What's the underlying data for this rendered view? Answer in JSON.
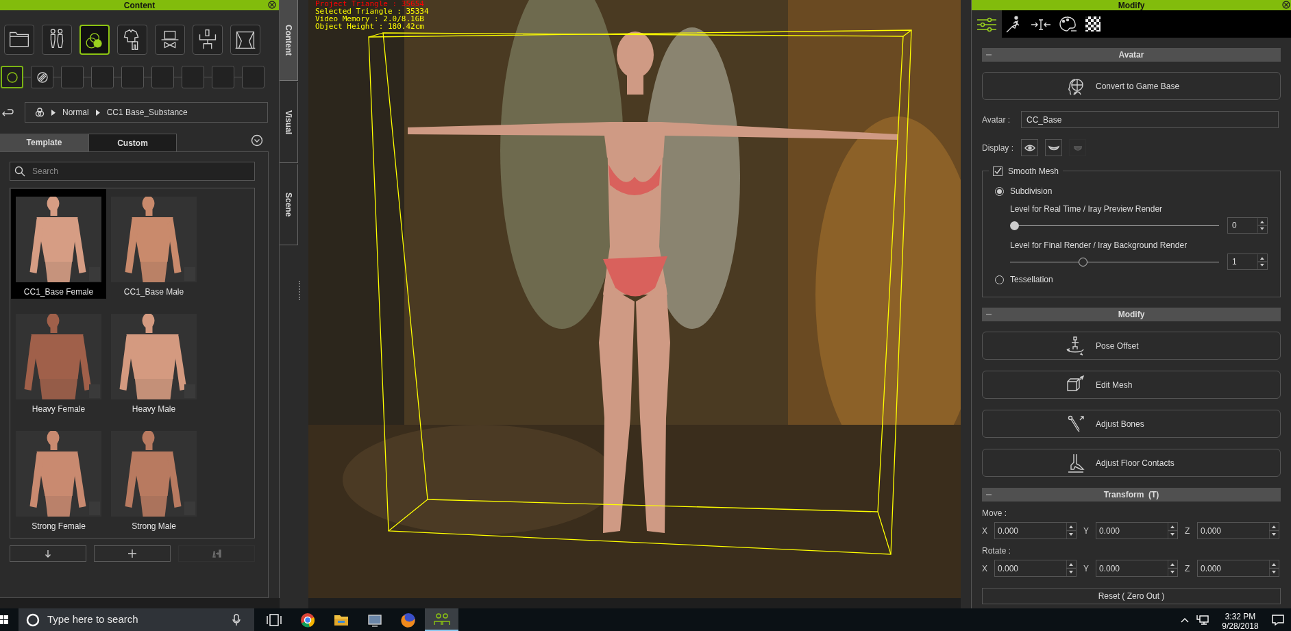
{
  "content_panel": {
    "title": "Content",
    "category_tabs": [
      {
        "selected": false
      },
      {
        "selected": false
      },
      {
        "selected": true
      },
      {
        "selected": false
      },
      {
        "selected": false
      },
      {
        "selected": false
      },
      {
        "selected": false
      }
    ],
    "filter_slots": [
      {
        "selected": true
      },
      {
        "selected": false
      },
      {
        "selected": false
      },
      {
        "selected": false
      },
      {
        "selected": false
      },
      {
        "selected": false
      },
      {
        "selected": false
      },
      {
        "selected": false
      },
      {
        "selected": false
      }
    ],
    "breadcrumb": [
      "Normal",
      "CC1 Base_Substance"
    ],
    "tabs": [
      {
        "label": "Template",
        "selected": true
      },
      {
        "label": "Custom",
        "selected": false
      }
    ],
    "search": {
      "placeholder": "Search"
    },
    "templates": [
      {
        "label": "CC1_Base Female",
        "selected": true,
        "kind": "picture"
      },
      {
        "label": "CC1_Base Male",
        "selected": false,
        "kind": "picture"
      },
      {
        "label": "Heavy Female",
        "selected": false,
        "kind": "picture"
      },
      {
        "label": "Heavy Male",
        "selected": false,
        "kind": "picture"
      },
      {
        "label": "Strong Female",
        "selected": false,
        "kind": "picture"
      },
      {
        "label": "Strong Male",
        "selected": false,
        "kind": "picture"
      }
    ],
    "bottom_buttons": [
      {
        "disabled": false
      },
      {
        "disabled": false
      },
      {
        "disabled": true
      }
    ]
  },
  "side_tabs": [
    {
      "label": "Content",
      "selected": true
    },
    {
      "label": "Visual",
      "selected": false
    },
    {
      "label": "Scene",
      "selected": false
    }
  ],
  "viewport": {
    "kind": "picture",
    "stats": [
      {
        "text": "Project Triangle : 35654",
        "color": "#ff0000"
      },
      {
        "text": "Selected Triangle : 35334",
        "color": "#ffff00"
      },
      {
        "text": "Video Memory : 2.0/8.1GB",
        "color": "#ffff00"
      },
      {
        "text": "Object Height : 180.42cm",
        "color": "#ffff00"
      }
    ]
  },
  "modify_panel": {
    "title": "Modify",
    "tabs": [
      {
        "selected": true
      },
      {
        "selected": false
      },
      {
        "selected": false
      },
      {
        "selected": false
      },
      {
        "selected": false
      }
    ],
    "avatar_section": {
      "title": "Avatar",
      "convert_button": "Convert to Game Base",
      "avatar_label": "Avatar :",
      "avatar_value": "CC_Base",
      "display_label": "Display :",
      "display_buttons": [
        {
          "disabled": false
        },
        {
          "disabled": false
        },
        {
          "disabled": true
        }
      ],
      "smooth_mesh": {
        "label": "Smooth Mesh",
        "checked": true
      },
      "options": [
        {
          "label": "Subdivision",
          "selected": true
        },
        {
          "label": "Tessellation",
          "selected": false
        }
      ],
      "levels": [
        {
          "label": "Level for Real Time / Iray Preview Render",
          "level": 0,
          "value": "0"
        },
        {
          "label": "Level for Final Render / Iray Background Render",
          "level": 0.34,
          "value": "1"
        }
      ]
    },
    "modify_section": {
      "title": "Modify",
      "buttons": [
        "Pose Offset",
        "Edit Mesh",
        "Adjust Bones",
        "Adjust Floor Contacts"
      ]
    },
    "transform_section": {
      "title": "Transform  (T)",
      "groups": [
        {
          "label": "Move :",
          "fields": [
            {
              "axis": "X",
              "value": "0.000"
            },
            {
              "axis": "Y",
              "value": "0.000"
            },
            {
              "axis": "Z",
              "value": "0.000"
            }
          ]
        },
        {
          "label": "Rotate :",
          "fields": [
            {
              "axis": "X",
              "value": "0.000"
            },
            {
              "axis": "Y",
              "value": "0.000"
            },
            {
              "axis": "Z",
              "value": "0.000"
            }
          ]
        }
      ],
      "reset_button": "Reset ( Zero Out )"
    }
  },
  "taskbar": {
    "search_placeholder": "Type here to search",
    "apps": [
      {
        "active": false
      },
      {
        "active": false
      },
      {
        "active": false
      },
      {
        "active": false
      },
      {
        "active": false
      },
      {
        "active": true
      }
    ],
    "time": "3:32 PM",
    "date": "9/28/2018"
  }
}
